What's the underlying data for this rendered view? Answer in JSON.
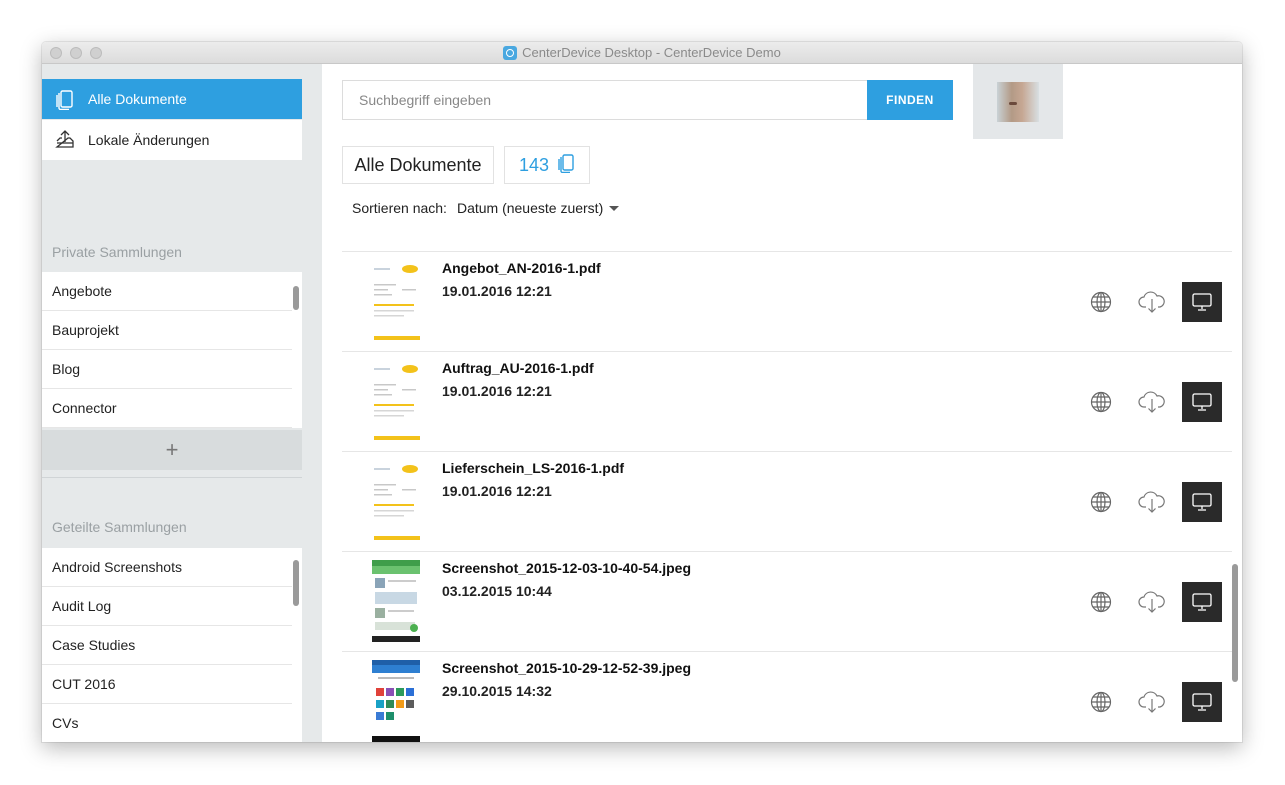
{
  "window": {
    "title": "CenterDevice Desktop - CenterDevice Demo"
  },
  "sidebar": {
    "nav": [
      {
        "label": "Alle Dokumente",
        "icon": "documents-icon",
        "active": true
      },
      {
        "label": "Lokale Änderungen",
        "icon": "upload-tray-icon",
        "active": false
      }
    ],
    "private_title": "Private Sammlungen",
    "private_collections": [
      "Angebote",
      "Bauprojekt",
      "Blog",
      "Connector"
    ],
    "add_label": "+",
    "shared_title": "Geteilte Sammlungen",
    "shared_collections": [
      "Android Screenshots",
      "Audit Log",
      "Case Studies",
      "CUT 2016",
      "CVs"
    ]
  },
  "search": {
    "placeholder": "Suchbegriff eingeben",
    "value": "",
    "button_label": "FINDEN"
  },
  "main": {
    "heading": "Alle Dokumente",
    "count": "143",
    "sort_label": "Sortieren nach:",
    "sort_value": "Datum (neueste zuerst)"
  },
  "documents": [
    {
      "name": "Angebot_AN-2016-1.pdf",
      "date": "19.01.2016 12:21",
      "thumb": "pdf"
    },
    {
      "name": "Auftrag_AU-2016-1.pdf",
      "date": "19.01.2016 12:21",
      "thumb": "pdf"
    },
    {
      "name": "Lieferschein_LS-2016-1.pdf",
      "date": "19.01.2016 12:21",
      "thumb": "pdf"
    },
    {
      "name": "Screenshot_2015-12-03-10-40-54.jpeg",
      "date": "03.12.2015 10:44",
      "thumb": "phone"
    },
    {
      "name": "Screenshot_2015-10-29-12-52-39.jpeg",
      "date": "29.10.2015 14:32",
      "thumb": "phone-grid"
    }
  ],
  "colors": {
    "accent": "#2e9fe0",
    "sidebar_bg": "#e6e9ea",
    "dark_button": "#2a2a2a"
  }
}
